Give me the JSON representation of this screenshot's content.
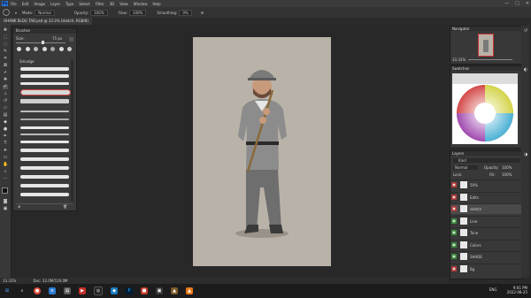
{
  "menu": {
    "logo": "Ps",
    "items": [
      "File",
      "Edit",
      "Image",
      "Layer",
      "Type",
      "Select",
      "Filter",
      "3D",
      "View",
      "Window",
      "Help"
    ],
    "window_controls": [
      "—",
      "□",
      "✕"
    ]
  },
  "options": {
    "mode_label": "Mode:",
    "mode_value": "Normal",
    "opacity_label": "Opacity:",
    "opacity_value": "100%",
    "flow_label": "Flow:",
    "flow_value": "100%",
    "smoothing_label": "Smoothing:",
    "smoothing_value": "0%"
  },
  "document": {
    "tab_title": "OHANK BLDG TAB.psd @ 33.3% (sketch, RGB/8)"
  },
  "brush_panel": {
    "title": "Brushes",
    "size_label": "Size:",
    "size_value": "75 px",
    "group_name": "Smudge"
  },
  "status": {
    "zoom": "33.33%",
    "doc_info": "Doc: 32.0M/120.0M"
  },
  "navigator": {
    "title": "Navigator",
    "zoom": "33.33%"
  },
  "swatches": {
    "title": "Swatches"
  },
  "layers": {
    "title": "Layers",
    "kind_label": "Kind",
    "blend_mode": "Normal",
    "opacity_label": "Opacity:",
    "opacity_value": "100%",
    "lock_label": "Lock:",
    "fill_label": "Fill:",
    "fill_value": "100%",
    "items": [
      {
        "name": "50%",
        "color": "#b03a3a"
      },
      {
        "name": "Edits",
        "color": "#b03a3a"
      },
      {
        "name": "sketch",
        "color": "#b03a3a"
      },
      {
        "name": "Line",
        "color": "#3c8a3c"
      },
      {
        "name": "Tone",
        "color": "#3c8a3c"
      },
      {
        "name": "Colors",
        "color": "#3c8a3c"
      },
      {
        "name": "SHADE",
        "color": "#3c8a3c"
      },
      {
        "name": "Bg",
        "color": "#b03a3a"
      }
    ]
  },
  "taskbar": {
    "time": "9:01 PM",
    "date": "2022-08-25",
    "lang": "ENG"
  }
}
